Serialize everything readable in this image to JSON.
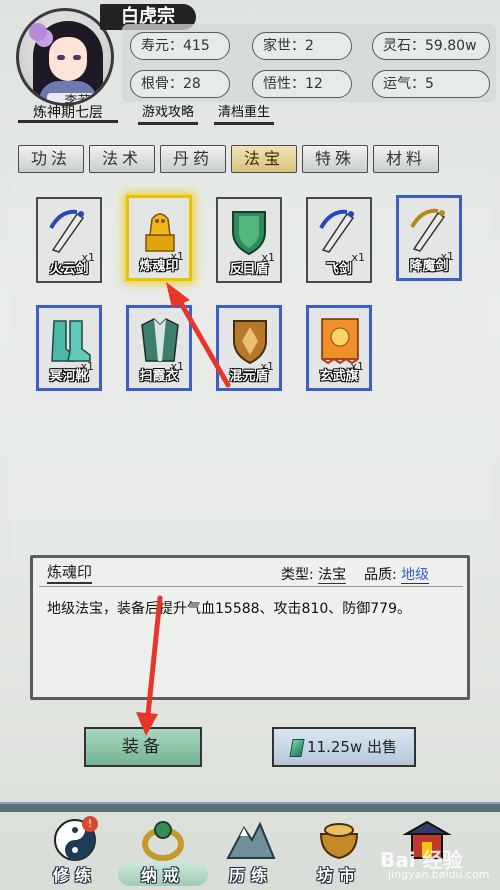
{
  "header": {
    "sect_name": "白虎宗",
    "character_name": "李若曦",
    "realm": "炼神期七层",
    "stats": {
      "lifespan": "寿元：415",
      "family": "家世：2",
      "spirit_stones": "灵石：59.80w",
      "bone": "根骨：28",
      "insight": "悟性：12",
      "luck": "运气：5"
    },
    "links": {
      "guide": "游戏攻略",
      "reset": "清档重生"
    }
  },
  "tabs": [
    {
      "label": "功法",
      "active": false
    },
    {
      "label": "法术",
      "active": false
    },
    {
      "label": "丹药",
      "active": false
    },
    {
      "label": "法宝",
      "active": true
    },
    {
      "label": "特殊",
      "active": false
    },
    {
      "label": "材料",
      "active": false
    }
  ],
  "inventory": [
    {
      "name": "火云剑",
      "count": "x1",
      "icon": "sword-icon",
      "border": "normal"
    },
    {
      "name": "炼魂印",
      "count": "x1",
      "icon": "golden-seal-icon",
      "border": "selected"
    },
    {
      "name": "反目盾",
      "count": "x1",
      "icon": "green-shield-icon",
      "border": "normal"
    },
    {
      "name": "飞剑",
      "count": "x1",
      "icon": "sword-icon",
      "border": "normal"
    },
    {
      "name": "降魔剑",
      "count": "x1",
      "icon": "sword-icon",
      "border": "blue"
    },
    {
      "name": "冥河靴",
      "count": "x1",
      "icon": "boots-icon",
      "border": "blue"
    },
    {
      "name": "扫霞衣",
      "count": "x1",
      "icon": "robe-icon",
      "border": "blue"
    },
    {
      "name": "混元盾",
      "count": "x1",
      "icon": "bronze-shield-icon",
      "border": "blue"
    },
    {
      "name": "玄武旗",
      "count": "x1",
      "icon": "flag-icon",
      "border": "blue"
    }
  ],
  "detail": {
    "name": "炼魂印",
    "type_label": "类型:",
    "type_value": "法宝",
    "quality_label": "品质:",
    "quality_value": "地级",
    "description": "地级法宝，装备后提升气血15588、攻击810、防御779。"
  },
  "actions": {
    "equip_label": "装备",
    "sell_label": "11.25w 出售"
  },
  "nav": [
    {
      "label": "修练",
      "icon": "yin-yang-icon",
      "badge": "!"
    },
    {
      "label": "纳戒",
      "icon": "ring-icon",
      "active": true
    },
    {
      "label": "历练",
      "icon": "mountain-icon"
    },
    {
      "label": "坊市",
      "icon": "cauldron-icon"
    },
    {
      "label": "宗门",
      "icon": "pavilion-icon"
    }
  ],
  "watermark": {
    "title": "Bai 经验",
    "url": "jingyan.baidu.com"
  },
  "colors": {
    "selected_border": "#e7c400",
    "blue_border": "#3b5fc7",
    "quality_color": "#3b5fc7",
    "arrow_color": "#e8352a"
  }
}
